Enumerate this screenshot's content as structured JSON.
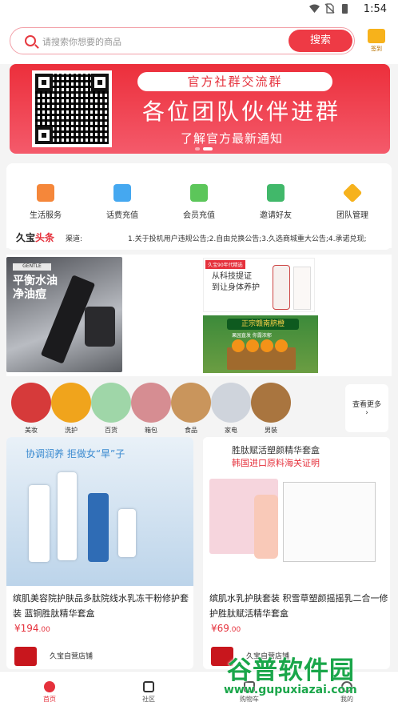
{
  "status": {
    "time": "1:54"
  },
  "search": {
    "placeholder": "请搜索你想要的商品",
    "button": "搜索",
    "sign_label": "签到"
  },
  "banner": {
    "pill": "官方社群交流群",
    "headline": "各位团队伙伴进群",
    "subline": "了解官方最新通知"
  },
  "menu": {
    "items": [
      {
        "label": "生活服务",
        "icon": "life-service-icon",
        "color": "#f5873a"
      },
      {
        "label": "话费充值",
        "icon": "phone-recharge-icon",
        "color": "#45a8f0"
      },
      {
        "label": "会员充值",
        "icon": "tv-member-icon",
        "color": "#5cc65a"
      },
      {
        "label": "邀请好友",
        "icon": "invite-icon",
        "color": "#41b86a"
      },
      {
        "label": "团队管理",
        "icon": "diamond-icon",
        "color": "#f6b21d"
      }
    ]
  },
  "news": {
    "logo_a": "久宝",
    "logo_b": "头条",
    "channel": "渠道:",
    "text": "1.关于投机用户违规公告;2.自由兑换公告;3.久选商城重大公告;4.承诺兑现;"
  },
  "promo": {
    "p1_tag": "GENTLE",
    "p1_title": "平衡水油\n净油痘",
    "p2_tag": "久宝90年代精选",
    "p2_title": "从科技提证\n到让身体养护",
    "p3_title": "正宗赣南脐橙",
    "p3_sub": "果园直发 你露浓郁"
  },
  "categories": [
    {
      "label": "美妆",
      "color": "#d63a3a"
    },
    {
      "label": "洗护",
      "color": "#f0a41c"
    },
    {
      "label": "百货",
      "color": "#9fd6a8"
    },
    {
      "label": "箱包",
      "color": "#d68d92"
    },
    {
      "label": "食品",
      "color": "#c9955c"
    },
    {
      "label": "家电",
      "color": "#cfd4dc"
    },
    {
      "label": "男装",
      "color": "#a9753f"
    }
  ],
  "more_label": "查看更多",
  "products": [
    {
      "img_title": "协调润养 拒做女“旱”子",
      "name": "缤肌美容院护肤品多肽院线水乳冻干粉修护套装 蓝铜胜肽精华套盒",
      "price_int": "¥194",
      "price_dec": ".00",
      "shop": "久宝自营店铺"
    },
    {
      "img_title": "胜肽赋活塑颜精华套盒",
      "img_sub": "韩国进口原料海关证明",
      "name": "缤肌水乳护肤套装 积雪草塑颜摇摇乳二合一修护胜肽赋活精华套盒",
      "price_int": "¥69",
      "price_dec": ".00",
      "shop": "久宝自营店铺"
    }
  ],
  "tabs": [
    {
      "label": "首页",
      "icon": "home-icon",
      "color": "#e5313c"
    },
    {
      "label": "社区",
      "icon": "community-icon",
      "color": "#333333"
    },
    {
      "label": "购物车",
      "icon": "cart-icon",
      "color": "#555555"
    },
    {
      "label": "我的",
      "icon": "profile-icon",
      "color": "#555555"
    }
  ],
  "watermark": {
    "brand": "谷普软件园",
    "url": "www.gupuxiazai.com"
  }
}
